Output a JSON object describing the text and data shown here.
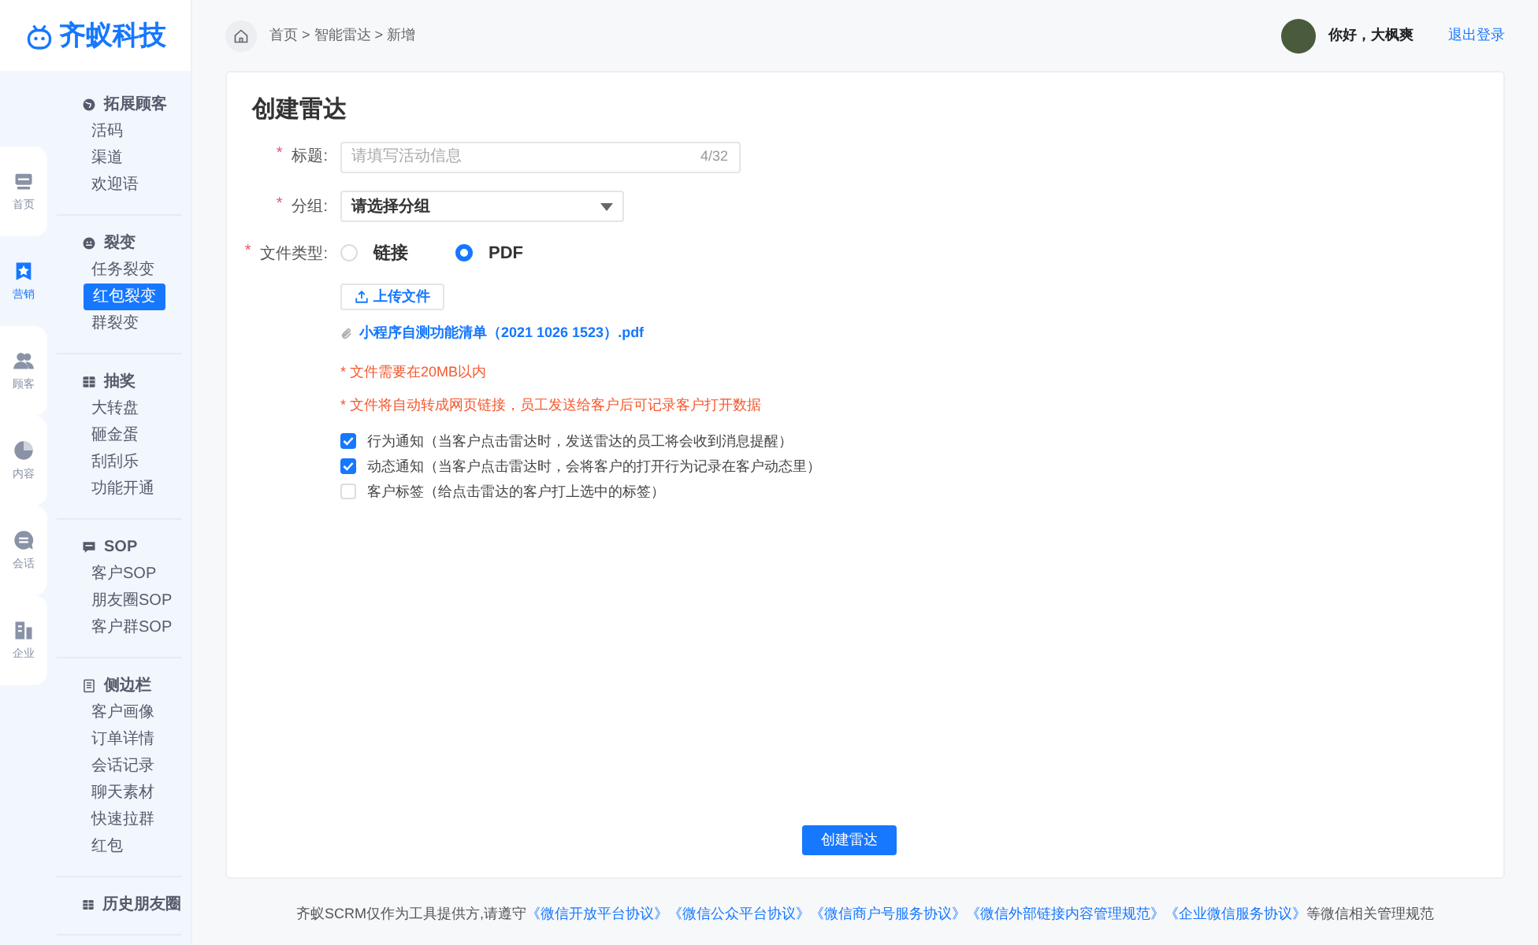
{
  "logo": {
    "text": "齐蚁科技"
  },
  "rail": [
    {
      "label": "首页",
      "selected": false
    },
    {
      "label": "营销",
      "selected": true
    },
    {
      "label": "顾客",
      "selected": false
    },
    {
      "label": "内容",
      "selected": false
    },
    {
      "label": "会话",
      "selected": false
    },
    {
      "label": "企业",
      "selected": false
    }
  ],
  "submenu": [
    {
      "title": "拓展顾客",
      "items": [
        {
          "label": "活码",
          "selected": false
        },
        {
          "label": "渠道",
          "selected": false
        },
        {
          "label": "欢迎语",
          "selected": false
        }
      ]
    },
    {
      "title": "裂变",
      "items": [
        {
          "label": "任务裂变",
          "selected": false
        },
        {
          "label": "红包裂变",
          "selected": true
        },
        {
          "label": "群裂变",
          "selected": false
        }
      ]
    },
    {
      "title": "抽奖",
      "items": [
        {
          "label": "大转盘",
          "selected": false
        },
        {
          "label": "砸金蛋",
          "selected": false
        },
        {
          "label": "刮刮乐",
          "selected": false
        },
        {
          "label": "功能开通",
          "selected": false
        }
      ]
    },
    {
      "title": "SOP",
      "items": [
        {
          "label": "客户SOP",
          "selected": false
        },
        {
          "label": "朋友圈SOP",
          "selected": false
        },
        {
          "label": "客户群SOP",
          "selected": false
        }
      ]
    },
    {
      "title": "侧边栏",
      "items": [
        {
          "label": "客户画像",
          "selected": false
        },
        {
          "label": "订单详情",
          "selected": false
        },
        {
          "label": "会话记录",
          "selected": false
        },
        {
          "label": "聊天素材",
          "selected": false
        },
        {
          "label": "快速拉群",
          "selected": false
        },
        {
          "label": "红包",
          "selected": false
        }
      ]
    },
    {
      "title": "历史朋友圈"
    }
  ],
  "breadcrumb": [
    "首页",
    "智能雷达",
    "新增"
  ],
  "breadcrumb_separator": ">",
  "user": {
    "greeting": "你好，大枫爽",
    "logout": "退出登录"
  },
  "form": {
    "title": "创建雷达",
    "fields": [
      {
        "kind": "text",
        "label": "标题:",
        "marker": "*",
        "placeholder": "请填写活动信息",
        "counter": "4/32"
      },
      {
        "kind": "select",
        "label": "分组:",
        "marker": "*",
        "value": "请选择分组"
      },
      {
        "kind": "radio",
        "label": "文件类型:",
        "marker": "*",
        "options": [
          {
            "label": "链接",
            "selected": false
          },
          {
            "label": "PDF",
            "selected": true
          }
        ]
      }
    ],
    "upload_button": "上传文件",
    "file_name": "小程序自测功能清单（2021 1026 1523）.pdf",
    "notes": [
      "* 文件需要在20MB以内",
      "* 文件将自动转成网页链接，员工发送给客户后可记录客户打开数据"
    ],
    "options": [
      {
        "label": "行为通知（当客户点击雷达时，发送雷达的员工将会收到消息提醒）",
        "checked": true
      },
      {
        "label": "动态通知（当客户点击雷达时，会将客户的打开行为记录在客户动态里）",
        "checked": true
      },
      {
        "label": "客户标签（给点击雷达的客户打上选中的标签）",
        "checked": false
      }
    ],
    "submit": "创建雷达"
  },
  "footer": {
    "prefix": "齐蚁SCRM仅作为工具提供方,请遵守",
    "links": [
      "《微信开放平台协议》",
      "《微信公众平台协议》",
      "《微信商户号服务协议》",
      "《微信外部链接内容管理规范》",
      "《企业微信服务协议》"
    ],
    "suffix": "等微信相关管理规范"
  }
}
